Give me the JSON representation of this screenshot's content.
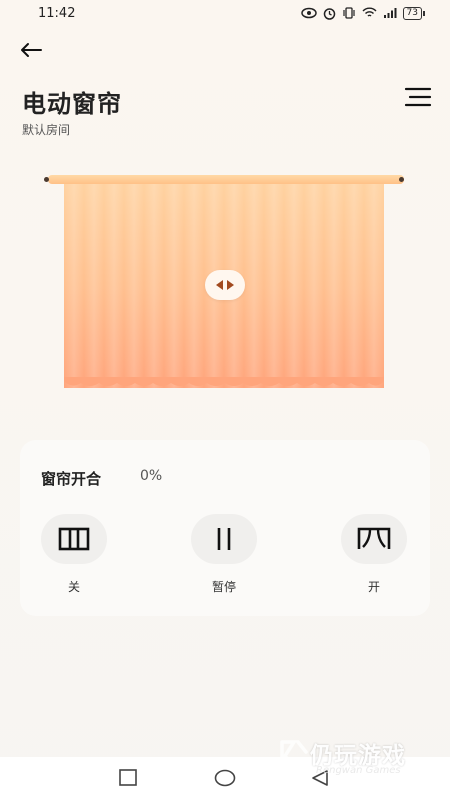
{
  "status_bar": {
    "time": "11:42",
    "battery": "73"
  },
  "header": {
    "title": "电动窗帘",
    "subtitle": "默认房间"
  },
  "curtain": {
    "open_fraction": 0.0
  },
  "control": {
    "label": "窗帘开合",
    "percent": "0%",
    "buttons": [
      {
        "label": "关",
        "icon": "curtain-close-icon"
      },
      {
        "label": "暂停",
        "icon": "pause-icon"
      },
      {
        "label": "开",
        "icon": "curtain-open-icon"
      }
    ]
  },
  "watermark": {
    "name": "仍玩游戏",
    "sub": "Rengwan Games"
  },
  "colors": {
    "curtain_top": "#ffd2a0",
    "curtain_bottom": "#ffa57c",
    "rod": "#ffc187"
  }
}
